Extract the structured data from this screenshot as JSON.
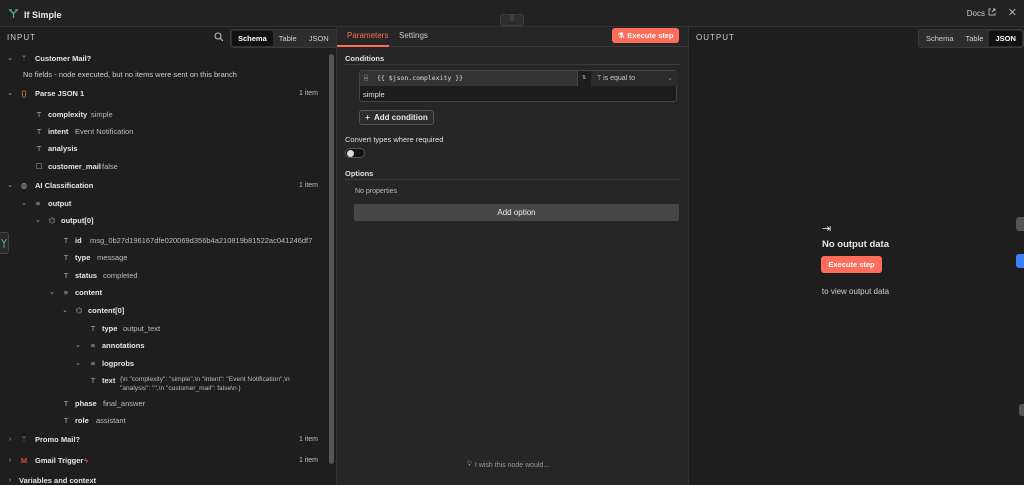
{
  "header": {
    "title": "If Simple",
    "docs_label": "Docs"
  },
  "input_panel": {
    "heading": "INPUT",
    "view_tabs": [
      "Schema",
      "Table",
      "JSON"
    ],
    "active_view": "Schema",
    "customer_mail": {
      "label": "Customer Mail?",
      "message": "No fields - node executed, but no items were sent on this branch"
    },
    "parse_json": {
      "label": "Parse JSON 1",
      "count": "1 item"
    },
    "fields": [
      {
        "key": "complexity",
        "value": "simple"
      },
      {
        "key": "intent",
        "value": "Event Notification"
      },
      {
        "key": "analysis",
        "value": ""
      },
      {
        "key": "customer_mail",
        "value": "false"
      }
    ],
    "ai_classification": {
      "label": "AI Classification",
      "count": "1 item"
    },
    "output": {
      "label": "output",
      "item0": "output[0]"
    },
    "output_fields": [
      {
        "key": "id",
        "value": "msg_0b27d196167dfe020069d356b4a210819b81522ac041246df7"
      },
      {
        "key": "type",
        "value": "message"
      },
      {
        "key": "status",
        "value": "completed"
      }
    ],
    "content": {
      "label": "content",
      "item0": "content[0]"
    },
    "content_fields": [
      {
        "key": "type",
        "value": "output_text"
      },
      {
        "key": "annotations",
        "value": ""
      },
      {
        "key": "logprobs",
        "value": ""
      }
    ],
    "text_field": {
      "key": "text",
      "value_line1": "{\\n \"complexity\": \"simple\",\\n \"intent\": \"Event Notification\",\\n",
      "value_line2": "\"analysis\": \"\",\\n \"customer_mail\": false\\n }"
    },
    "phase": {
      "key": "phase",
      "value": "final_answer"
    },
    "role": {
      "key": "role",
      "value": "assistant"
    },
    "promo_mail": {
      "label": "Promo Mail?",
      "count": "1 item"
    },
    "gmail_trigger": {
      "label": "Gmail Trigger",
      "count": "1 item"
    },
    "variables": {
      "label": "Variables and context"
    }
  },
  "parameters_panel": {
    "tabs": [
      "Parameters",
      "Settings"
    ],
    "execute_label": "Execute step",
    "conditions_heading": "Conditions",
    "condition": {
      "expression": "{{ $json.complexity }}",
      "operator": "is equal to",
      "value": "simple"
    },
    "add_condition_label": "Add condition",
    "convert_types_label": "Convert types where required",
    "convert_types_on": false,
    "options_heading": "Options",
    "no_properties": "No properties",
    "add_option_label": "Add option",
    "wish_label": "I wish this node would..."
  },
  "output_panel": {
    "heading": "OUTPUT",
    "view_tabs": [
      "Schema",
      "Table",
      "JSON"
    ],
    "active_view": "JSON",
    "no_data": "No output data",
    "execute_label": "Execute step",
    "to_view": "to view output data"
  },
  "colors": {
    "accent": "#ff6d5a",
    "background": "#1e1e1e",
    "node_green": "#4cb37d"
  }
}
